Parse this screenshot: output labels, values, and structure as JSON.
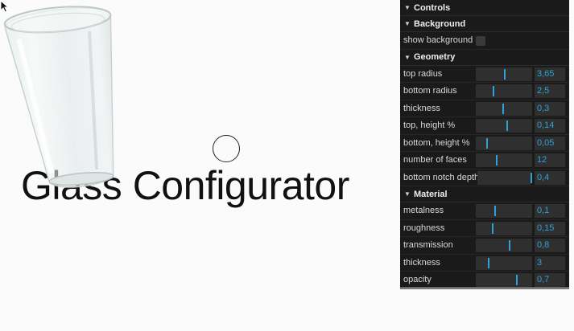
{
  "scene": {
    "title": "Glass Configurator"
  },
  "gui": {
    "title": "Controls",
    "folders": [
      {
        "name": "Background",
        "rows": [
          {
            "label": "show background",
            "type": "checkbox",
            "checked": false
          }
        ]
      },
      {
        "name": "Geometry",
        "rows": [
          {
            "label": "top radius",
            "value": "3,65",
            "fill": 0.5
          },
          {
            "label": "bottom radius",
            "value": "2,5",
            "fill": 0.3
          },
          {
            "label": "thickness",
            "value": "0,3",
            "fill": 0.47
          },
          {
            "label": "top, height %",
            "value": "0,14",
            "fill": 0.54
          },
          {
            "label": "bottom, height %",
            "value": "0,05",
            "fill": 0.19
          },
          {
            "label": "number of faces",
            "value": "12",
            "fill": 0.36
          },
          {
            "label": "bottom notch depth",
            "value": "0,4",
            "fill": 0.99
          }
        ]
      },
      {
        "name": "Material",
        "rows": [
          {
            "label": "metalness",
            "value": "0,1",
            "fill": 0.33
          },
          {
            "label": "roughness",
            "value": "0,15",
            "fill": 0.29
          },
          {
            "label": "transmission",
            "value": "0,8",
            "fill": 0.58
          },
          {
            "label": "thickness",
            "value": "3",
            "fill": 0.21
          },
          {
            "label": "opacity",
            "value": "0,7",
            "fill": 0.72
          }
        ]
      }
    ]
  },
  "colors": {
    "accent": "#2fa1d6",
    "panel_bg": "#1a1a1a",
    "field_bg": "#2f2f2f"
  },
  "icons": {
    "chevron": "chevron-down-icon",
    "cursor": "pointer-arrow-icon"
  }
}
